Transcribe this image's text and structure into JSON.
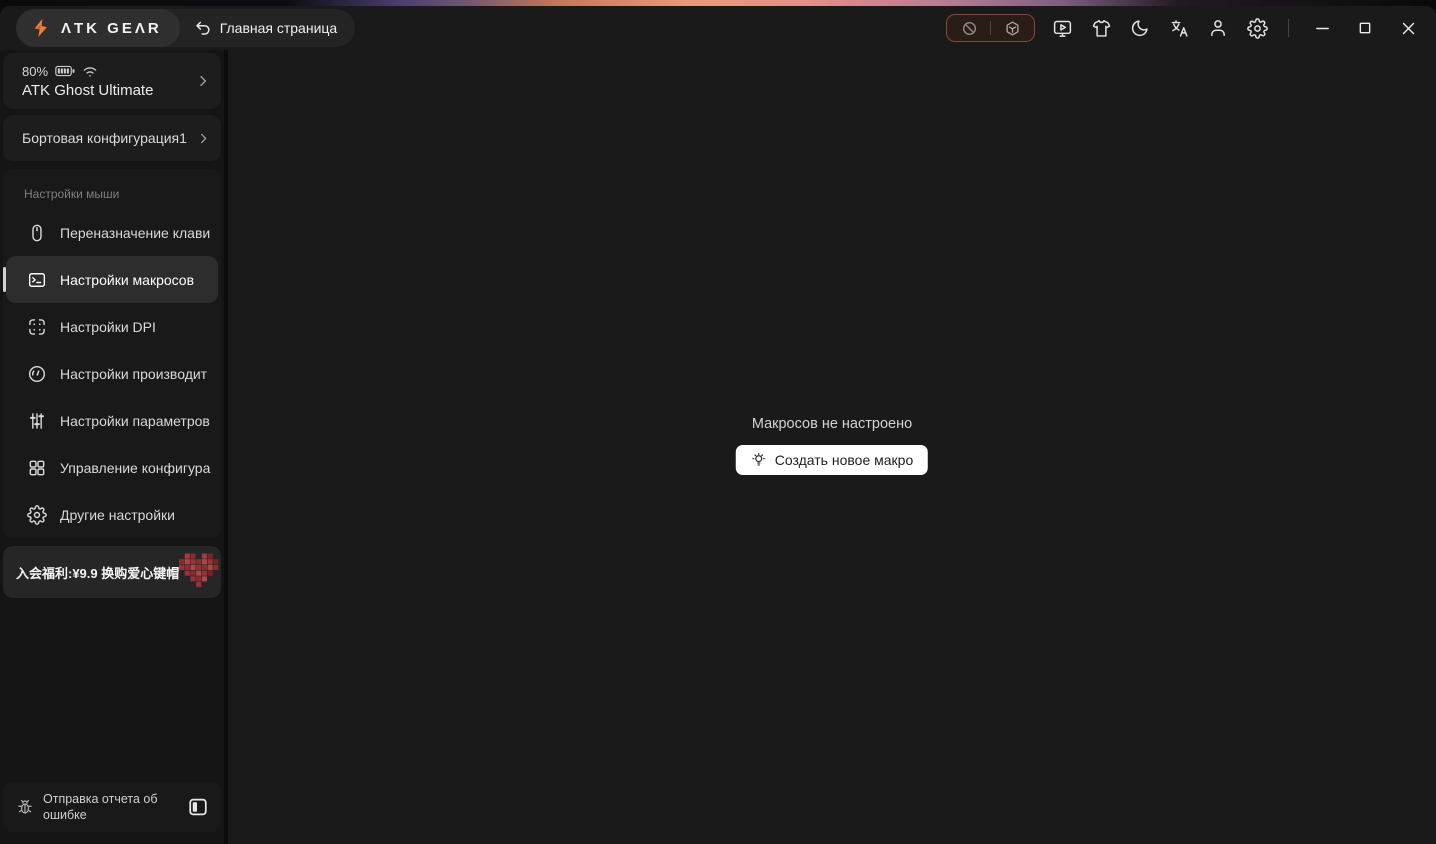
{
  "titlebar": {
    "brand": "ΛTK GEΛR",
    "page_title": "Главная страница"
  },
  "sidebar": {
    "device": {
      "battery": "80%",
      "name": "ATK Ghost Ultimate"
    },
    "config": {
      "label": "Бортовая конфигурация1"
    },
    "section_label": "Настройки мыши",
    "items": [
      {
        "label": "Переназначение клави",
        "icon": "mouse-icon",
        "active": false
      },
      {
        "label": "Настройки макросов",
        "icon": "terminal-icon",
        "active": true
      },
      {
        "label": "Настройки DPI",
        "icon": "dpi-target-icon",
        "active": false
      },
      {
        "label": "Настройки производит",
        "icon": "gauge-icon",
        "active": false
      },
      {
        "label": "Настройки параметров",
        "icon": "sliders-icon",
        "active": false
      },
      {
        "label": "Управление конфигура",
        "icon": "grid-icon",
        "active": false
      },
      {
        "label": "Другие настройки",
        "icon": "gear-icon",
        "active": false
      }
    ],
    "promo": {
      "text": "入会福利:¥9.9 换购爱心键帽"
    },
    "report": {
      "label": "Отправка отчета об ошибке"
    }
  },
  "main": {
    "empty_title": "Макросов не настроено",
    "create_button_label": "Создать новое макро"
  },
  "icons": [
    "lightning-logo-icon",
    "back-undo-icon",
    "blocked-icon",
    "box-3d-icon",
    "screen-play-icon",
    "tshirt-icon",
    "moon-icon",
    "translate-icon",
    "user-icon",
    "settings-gear-icon",
    "minimize-icon",
    "maximize-icon",
    "close-icon",
    "battery-icon",
    "wifi-icon",
    "chevron-right-icon",
    "mouse-icon",
    "terminal-icon",
    "dpi-target-icon",
    "gauge-icon",
    "sliders-icon",
    "grid-icon",
    "gear-icon",
    "bug-icon",
    "collapse-sidebar-icon",
    "bulb-icon",
    "heart-keycap-image"
  ],
  "colors": {
    "accent_orange": "#f07c35",
    "window_bg": "#1a1a1a",
    "sidebar_bg": "#151515",
    "active_item_bg": "#2d2d2d",
    "device_pill_border": "#7d4a35",
    "button_bg": "#ffffff",
    "heart_red": "#9c3038"
  }
}
